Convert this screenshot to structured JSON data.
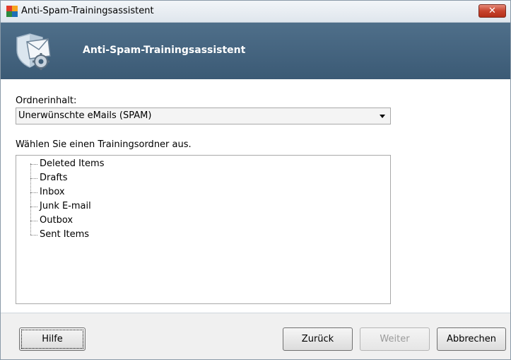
{
  "window": {
    "title": "Anti-Spam-Trainingsassistent",
    "close_label": "✕"
  },
  "banner": {
    "title": "Anti-Spam-Trainingsassistent"
  },
  "form": {
    "folder_content_label": "Ordnerinhalt:",
    "folder_content_value": "Unerwünschte eMails (SPAM)",
    "choose_folder_label": "Wählen Sie einen Trainingsordner aus."
  },
  "tree": {
    "items": [
      {
        "label": "Deleted Items"
      },
      {
        "label": "Drafts"
      },
      {
        "label": "Inbox"
      },
      {
        "label": "Junk E-mail"
      },
      {
        "label": "Outbox"
      },
      {
        "label": "Sent Items"
      }
    ]
  },
  "buttons": {
    "help": "Hilfe",
    "back": "Zurück",
    "next": "Weiter",
    "cancel": "Abbrechen",
    "next_enabled": false
  },
  "icons": {
    "app": "avg-logo-icon",
    "banner": "shield-mail-gear-icon"
  },
  "colors": {
    "banner_background": "#3f5e79",
    "close_button": "#c7432d"
  }
}
